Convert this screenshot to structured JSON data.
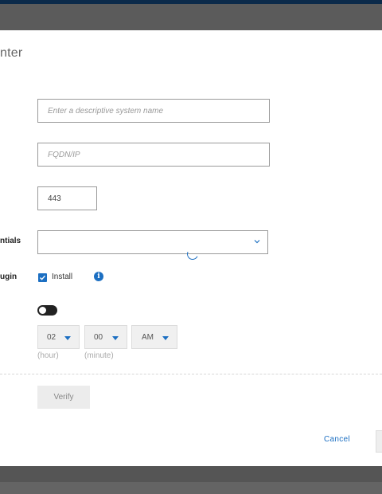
{
  "dialog": {
    "title": "nter",
    "labels": {
      "credentials": "ntials",
      "plugin": "ugin"
    },
    "system_name": {
      "placeholder": "Enter a descriptive system name",
      "value": ""
    },
    "fqdn": {
      "placeholder": "FQDN/IP",
      "value": ""
    },
    "port": {
      "value": "443"
    },
    "credentials_select": {
      "value": ""
    },
    "plugin": {
      "checked": true,
      "label": "Install"
    },
    "schedule": {
      "hour": "02",
      "minute": "00",
      "ampm": "AM",
      "hour_caption": "(hour)",
      "minute_caption": "(minute)"
    },
    "verify_label": "Verify",
    "cancel_label": "Cancel"
  },
  "colors": {
    "accent": "#1c6fc2",
    "topbar": "#0b2a4a",
    "overlay": "#5e5e5e"
  },
  "icons": [
    "chevron-down-icon",
    "loading-spinner-icon",
    "checkmark-icon",
    "info-icon",
    "dropdown-arrow-icon"
  ]
}
